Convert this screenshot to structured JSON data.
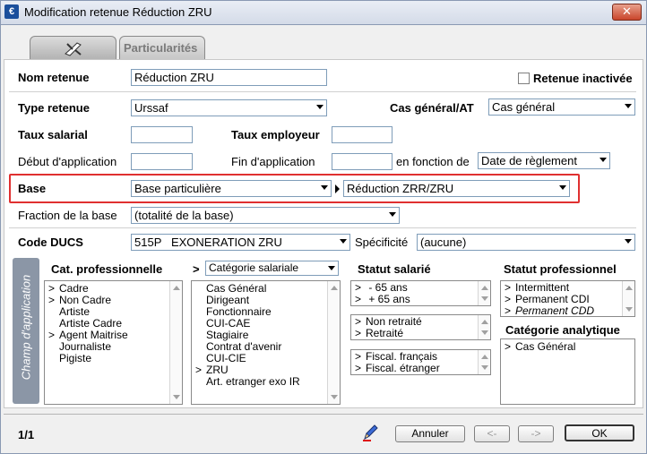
{
  "window": {
    "title": "Modification retenue Réduction ZRU",
    "app_icon": "€",
    "close_icon": "✕"
  },
  "tabs": {
    "main_icon": "tool-icon",
    "particularites": "Particularités"
  },
  "form": {
    "nom_retenue_label": "Nom retenue",
    "nom_retenue_value": "Réduction ZRU",
    "retenue_inactivee_label": "Retenue inactivée",
    "type_retenue_label": "Type retenue",
    "type_retenue_value": "Urssaf",
    "cas_general_label": "Cas général/AT",
    "cas_general_value": "Cas général",
    "taux_salarial_label": "Taux salarial",
    "taux_employeur_label": "Taux employeur",
    "debut_label": "Début d'application",
    "fin_label": "Fin d'application",
    "en_fonction_label": "en fonction de",
    "en_fonction_value": "Date de règlement",
    "base_label": "Base",
    "base_value": "Base particulière",
    "base_detail_value": "Réduction ZRR/ZRU",
    "fraction_label": "Fraction de la base",
    "fraction_value": "(totalité de la base)",
    "code_ducs_label": "Code DUCS",
    "code_ducs_value": "515P   EXONERATION ZRU",
    "specificite_label": "Spécificité",
    "specificite_value": "(aucune)"
  },
  "champ": {
    "side_label": "Champ d'application",
    "cat_pro_header": "Cat. professionnelle",
    "cat_pro_items": [
      {
        "mark": ">",
        "label": "Cadre"
      },
      {
        "mark": ">",
        "label": "Non Cadre"
      },
      {
        "mark": "",
        "label": "Artiste"
      },
      {
        "mark": "",
        "label": "Artiste Cadre"
      },
      {
        "mark": ">",
        "label": "Agent Maitrise"
      },
      {
        "mark": "",
        "label": "Journaliste"
      },
      {
        "mark": "",
        "label": "Pigiste"
      }
    ],
    "cat_sal_prefix": ">",
    "cat_sal_select": "Catégorie salariale",
    "cat_sal_items": [
      {
        "mark": "",
        "label": "Cas Général"
      },
      {
        "mark": "",
        "label": "Dirigeant"
      },
      {
        "mark": "",
        "label": "Fonctionnaire"
      },
      {
        "mark": "",
        "label": "CUI-CAE"
      },
      {
        "mark": "",
        "label": "Stagiaire"
      },
      {
        "mark": "",
        "label": "Contrat d'avenir"
      },
      {
        "mark": "",
        "label": "CUI-CIE"
      },
      {
        "mark": ">",
        "label": "ZRU"
      },
      {
        "mark": "",
        "label": "Art. etranger exo IR"
      }
    ],
    "statut_salarie_header": "Statut salarié",
    "statut_age": [
      {
        "mark": ">",
        "label": " - 65 ans"
      },
      {
        "mark": ">",
        "label": " + 65 ans"
      }
    ],
    "statut_retraite": [
      {
        "mark": ">",
        "label": "Non retraité"
      },
      {
        "mark": ">",
        "label": "Retraité"
      }
    ],
    "statut_fiscal": [
      {
        "mark": ">",
        "label": "Fiscal. français"
      },
      {
        "mark": ">",
        "label": "Fiscal. étranger"
      }
    ],
    "statut_pro_header": "Statut professionnel",
    "statut_pro_items": [
      {
        "mark": ">",
        "label": "Intermittent"
      },
      {
        "mark": ">",
        "label": "Permanent CDI"
      },
      {
        "mark": ">",
        "label": "Permanent CDD"
      }
    ],
    "cat_analytique_header": "Catégorie analytique",
    "cat_analytique_items": [
      {
        "mark": ">",
        "label": "Cas Général"
      }
    ]
  },
  "footer": {
    "page_count": "1/1",
    "annuler": "Annuler",
    "prev": "<-",
    "next": "->",
    "ok": "OK"
  }
}
